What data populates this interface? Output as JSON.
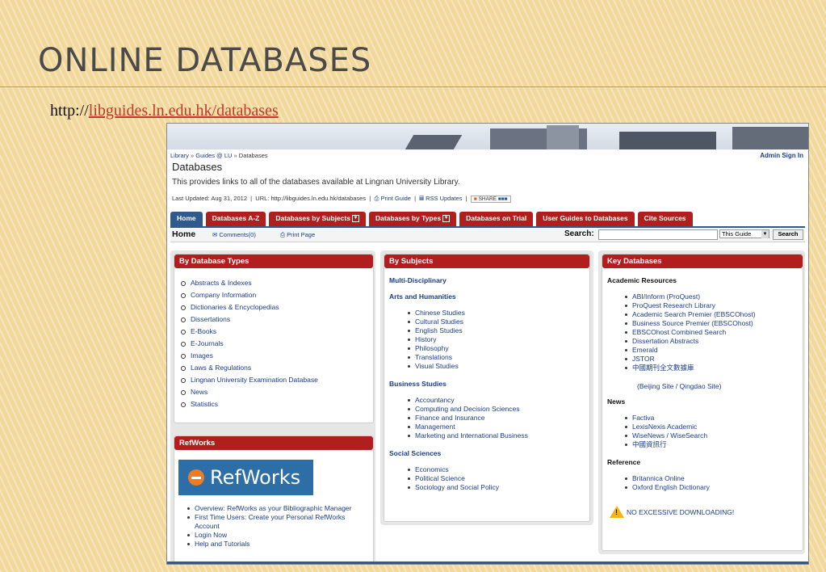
{
  "slide": {
    "title": "ONLINE DATABASES",
    "url_prefix": "http://",
    "url_link": "libguides.ln.edu.hk/databases"
  },
  "page": {
    "breadcrumb": [
      "Library",
      "Guides @ LU",
      "Databases"
    ],
    "breadcrumb_sep": "»",
    "admin_link": "Admin Sign In",
    "guide_title": "Databases",
    "description": "This provides links to all of the databases available at Lingnan University Library.",
    "last_updated": "Last Updated: Aug 31, 2012",
    "url_text": "URL: http://libguides.ln.edu.hk/databases",
    "print_guide": "Print Guide",
    "rss": "RSS Updates",
    "share": "SHARE"
  },
  "tabs": [
    {
      "label": "Home",
      "dropdown": false
    },
    {
      "label": "Databases A-Z",
      "dropdown": false
    },
    {
      "label": "Databases by Subjects",
      "dropdown": true
    },
    {
      "label": "Databases by Types",
      "dropdown": true
    },
    {
      "label": "Databases on Trial",
      "dropdown": false
    },
    {
      "label": "User Guides to Databases",
      "dropdown": false
    },
    {
      "label": "Cite Sources",
      "dropdown": false
    }
  ],
  "subbar": {
    "page_label": "Home",
    "comments": "Comments(0)",
    "print_page": "Print Page",
    "search_label": "Search:",
    "scope": "This Guide",
    "search_button": "Search"
  },
  "by_types": {
    "heading": "By Database Types",
    "items": [
      "Abstracts & Indexes",
      "Company Information",
      "Dictionaries & Encyclopedias",
      "Dissertations",
      "E-Books",
      "E-Journals",
      "Images",
      "Laws & Regulations",
      "Lingnan University Examination Database",
      "News",
      "Statistics"
    ]
  },
  "refworks": {
    "heading": "RefWorks",
    "logo_text": "RefWorks",
    "items": [
      "Overview: RefWorks as your Bibliographic Manager",
      "First Time Users: Create your Personal RefWorks Account",
      "Login Now",
      "Help and Tutorials"
    ]
  },
  "by_subjects": {
    "heading": "By Subjects",
    "multi": "Multi-Disciplinary",
    "sections": [
      {
        "title": "Arts and Humanities",
        "items": [
          "Chinese Studies",
          "Cultural Studies",
          "English Studies",
          "History",
          "Philosophy",
          "Translations",
          "Visual Studies"
        ]
      },
      {
        "title": "Business Studies",
        "items": [
          "Accountancy",
          "Computing and Decision Sciences",
          "Finance and Insurance",
          "Management",
          "Marketing and International Business"
        ]
      },
      {
        "title": "Social Sciences",
        "items": [
          "Economics",
          "Political Science",
          "Sociology and Social Policy"
        ]
      }
    ]
  },
  "key_databases": {
    "heading": "Key Databases",
    "academic_title": "Academic Resources",
    "academic": [
      "ABI/Inform (ProQuest)",
      "ProQuest Research Library",
      "Academic Search Premier (EBSCOhost)",
      "Business Source Premier (EBSCOhost)",
      "EBSCOhost Combined Search",
      "Dissertation Abstracts",
      "Emerald",
      "JSTOR",
      "中國期刊全文數據庫"
    ],
    "cnki_sites": "(Beijing Site / Qingdao Site)",
    "news_title": "News",
    "news": [
      "Factiva",
      "LexisNexis Academic",
      "WiseNews / WiseSearch",
      "中國資訊行"
    ],
    "reference_title": "Reference",
    "reference": [
      "Britannica Online",
      "Oxford English Dictionary"
    ],
    "warning": "NO EXCESSIVE DOWNLOADING!"
  }
}
